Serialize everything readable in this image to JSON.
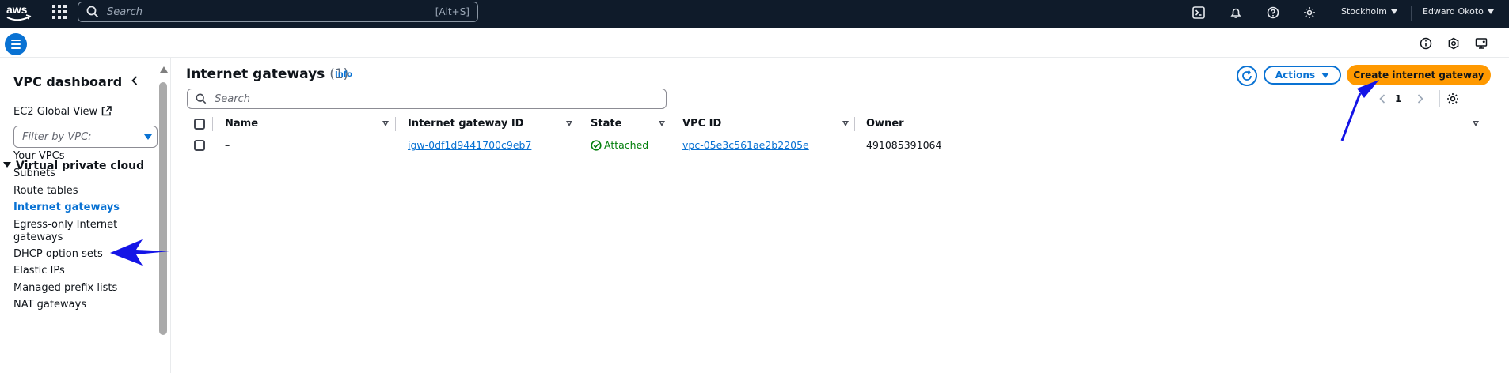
{
  "topnav": {
    "logo_alt": "aws",
    "search_placeholder": "Search",
    "search_shortcut": "[Alt+S]",
    "icons": [
      "cloudshell-icon",
      "bell-icon",
      "help-icon",
      "gear-icon"
    ],
    "region": "Stockholm",
    "user": "Edward Okoto"
  },
  "sidebar": {
    "title": "VPC dashboard",
    "ec2_global_view": "EC2 Global View",
    "filter_placeholder": "Filter by VPC:",
    "section": "Virtual private cloud",
    "items": [
      {
        "label": "Your VPCs"
      },
      {
        "label": "Subnets"
      },
      {
        "label": "Route tables"
      },
      {
        "label": "Internet gateways"
      },
      {
        "label": "Egress-only Internet gateways"
      },
      {
        "label": "DHCP option sets"
      },
      {
        "label": "Elastic IPs"
      },
      {
        "label": "Managed prefix lists"
      },
      {
        "label": "NAT gateways"
      }
    ]
  },
  "main": {
    "title": "Internet gateways",
    "count": "(1)",
    "info": "Info",
    "actions_label": "Actions",
    "create_label": "Create internet gateway",
    "search_placeholder": "Search",
    "page": "1",
    "columns": [
      "Name",
      "Internet gateway ID",
      "State",
      "VPC ID",
      "Owner"
    ],
    "rows": [
      {
        "name": "–",
        "igw_id": "igw-0df1d9441700c9eb7",
        "state": "Attached",
        "vpc_id": "vpc-05e3c561ae2b2205e",
        "owner": "491085391064"
      }
    ]
  },
  "colors": {
    "accent": "#0972d3",
    "primary_button": "#ff9900",
    "nav_bg": "#0f1b2a",
    "success": "#037f0c",
    "annotation_arrow": "#1414e6"
  }
}
